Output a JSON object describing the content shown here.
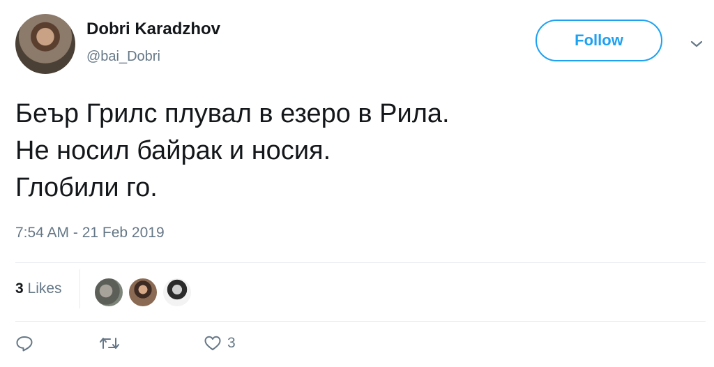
{
  "user": {
    "name": "Dobri Karadzhov",
    "handle": "@bai_Dobri"
  },
  "follow_label": "Follow",
  "tweet": {
    "lines": [
      "Беър Грилс плувал в езеро в Рила.",
      "Не носил байрак и носия.",
      "Глобили го."
    ],
    "timestamp": "7:54 AM - 21 Feb 2019"
  },
  "stats": {
    "likes_count": "3",
    "likes_label": "Likes"
  },
  "actions": {
    "like_count": "3"
  },
  "colors": {
    "accent": "#1da1f2",
    "muted": "#657786",
    "text": "#14171a",
    "divider": "#e6ecf0"
  },
  "icons": {
    "caret": "chevron-down-icon",
    "reply": "reply-icon",
    "retweet": "retweet-icon",
    "like": "heart-icon"
  }
}
